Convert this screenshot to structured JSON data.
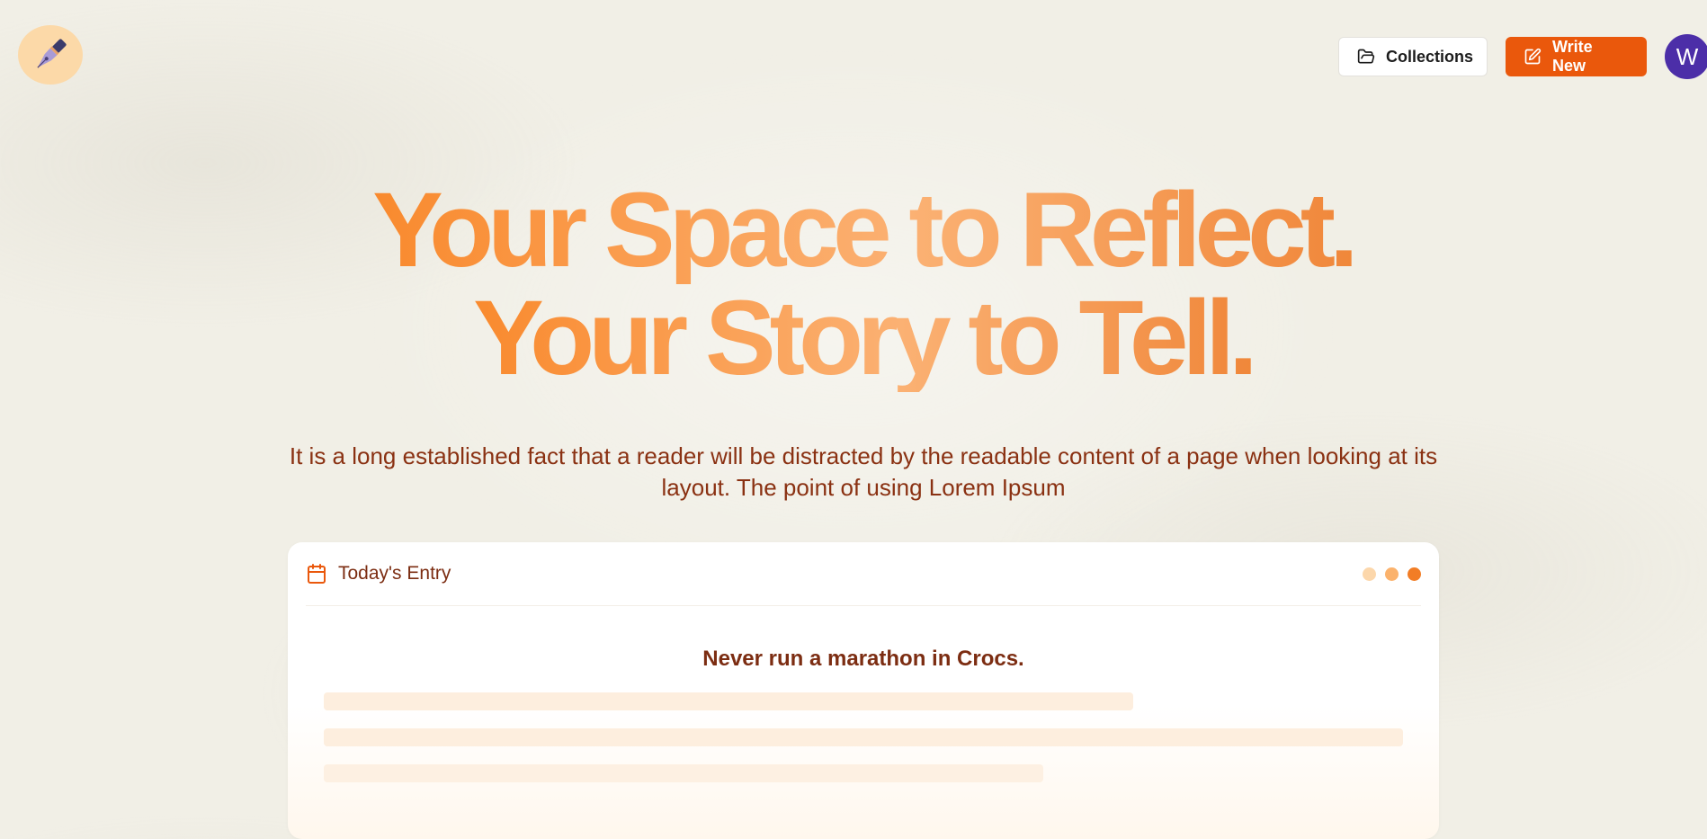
{
  "header": {
    "logo_icon": "fountain-pen-icon",
    "collections_label": "Collections",
    "collections_icon": "folder-open-icon",
    "write_label": "Write New",
    "write_icon": "edit-icon",
    "avatar_initial": "W"
  },
  "hero": {
    "title_line1": "Your Space to Reflect.",
    "title_line2": "Your Story to Tell.",
    "subtitle": "It is a long established fact that a reader will be distracted by the readable content of a page when looking at its layout. The point of using Lorem Ipsum"
  },
  "entry_card": {
    "icon": "calendar-icon",
    "label": "Today's Entry",
    "heading": "Never run a marathon in Crocs."
  },
  "colors": {
    "background": "#f1efe6",
    "accent": "#ea580c",
    "text_brown": "#7c2d12",
    "avatar": "#4c2ea8",
    "logo_bg": "#fcd9a8"
  }
}
